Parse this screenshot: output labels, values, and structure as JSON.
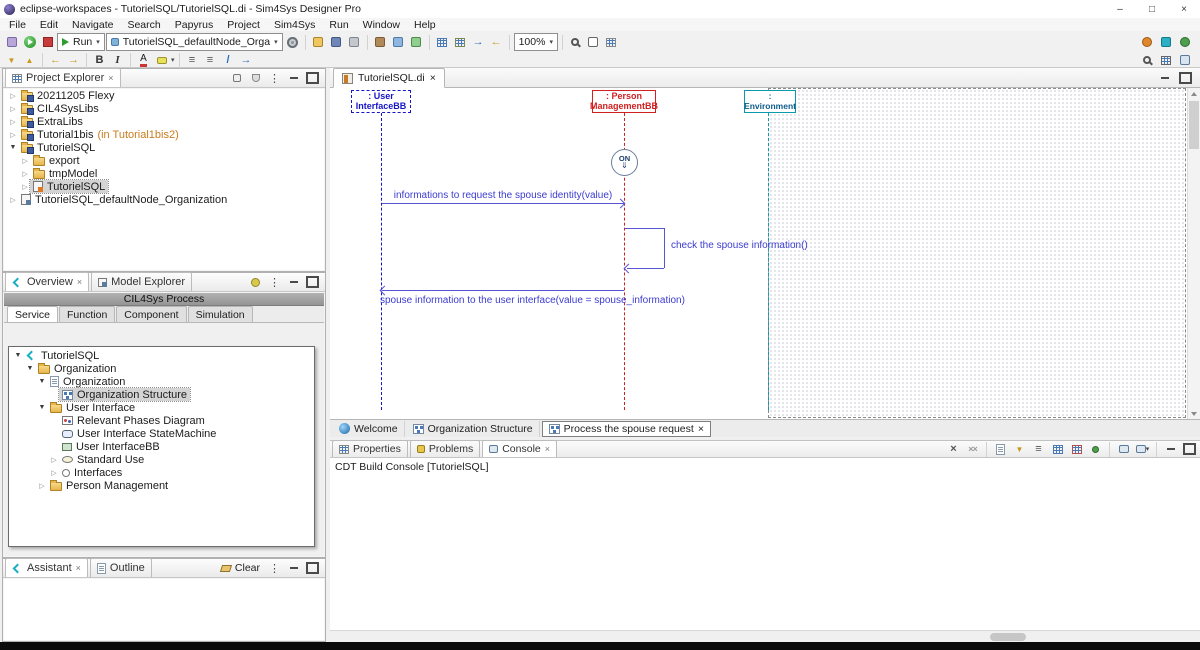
{
  "window": {
    "title": "eclipse-workspaces - TutorielSQL/TutorielSQL.di - Sim4Sys Designer Pro"
  },
  "icons": {
    "minimize": "–",
    "maximize": "□",
    "close": "×",
    "dropdown": "▾",
    "overflow": "⋮"
  },
  "menubar": {
    "items": [
      "File",
      "Edit",
      "Navigate",
      "Search",
      "Papyrus",
      "Project",
      "Sim4Sys",
      "Run",
      "Window",
      "Help"
    ]
  },
  "toolbar": {
    "run_label": "Run",
    "launch_config": "TutorielSQL_defaultNode_Orga",
    "zoom": "100%",
    "bold": "B",
    "italic": "I",
    "font_letter": "A"
  },
  "project_explorer": {
    "title": "Project Explorer",
    "items": [
      {
        "label": "20211205 Flexy"
      },
      {
        "label": "CIL4SysLibs"
      },
      {
        "label": "ExtraLibs"
      },
      {
        "label": "Tutorial1bis",
        "suffix": " (in Tutorial1bis2)"
      },
      {
        "label": "TutorielSQL"
      },
      {
        "label": "export"
      },
      {
        "label": "tmpModel"
      },
      {
        "label": "TutorielSQL"
      },
      {
        "label": "TutorielSQL_defaultNode_Organization"
      }
    ]
  },
  "overview": {
    "tab_overview": "Overview",
    "tab_model_explorer": "Model Explorer",
    "process_title": "CIL4Sys Process",
    "subtabs": [
      "Service",
      "Function",
      "Component",
      "Simulation"
    ],
    "tree": [
      {
        "label": "TutorielSQL"
      },
      {
        "label": "Organization"
      },
      {
        "label": "Organization"
      },
      {
        "label": "Organization Structure"
      },
      {
        "label": "User Interface"
      },
      {
        "label": "Relevant Phases Diagram"
      },
      {
        "label": "User Interface StateMachine"
      },
      {
        "label": "User InterfaceBB"
      },
      {
        "label": "Standard Use"
      },
      {
        "label": "Interfaces"
      },
      {
        "label": "Person Management"
      }
    ]
  },
  "assistant": {
    "tab_assistant": "Assistant",
    "tab_outline": "Outline",
    "clear_label": "Clear"
  },
  "editor": {
    "tab_title": "TutorielSQL.di",
    "bottom_tabs": [
      "Welcome",
      "Organization Structure",
      "Process the spouse request"
    ]
  },
  "diagram": {
    "lifelines": [
      {
        "line1": ": User",
        "line2": "InterfaceBB"
      },
      {
        "line1": ": Person",
        "line2": "ManagementBB"
      },
      {
        "line1": ":",
        "line2": "Environment"
      }
    ],
    "on_symbol": "ON",
    "on_arrow": "⇓",
    "messages": {
      "request": "informations to request the spouse identity(value)",
      "self_check": "check the spouse information()",
      "reply": "spouse information to the user interface(value = spouse_information)"
    },
    "colors": {
      "user_lifeline": "#1616c8",
      "person_lifeline": "#d02020",
      "environment_lifeline": "#0b9aad",
      "message": "#5555d5"
    }
  },
  "console": {
    "tab_properties": "Properties",
    "tab_problems": "Problems",
    "tab_console": "Console",
    "content_line": "CDT Build Console [TutorielSQL]"
  }
}
